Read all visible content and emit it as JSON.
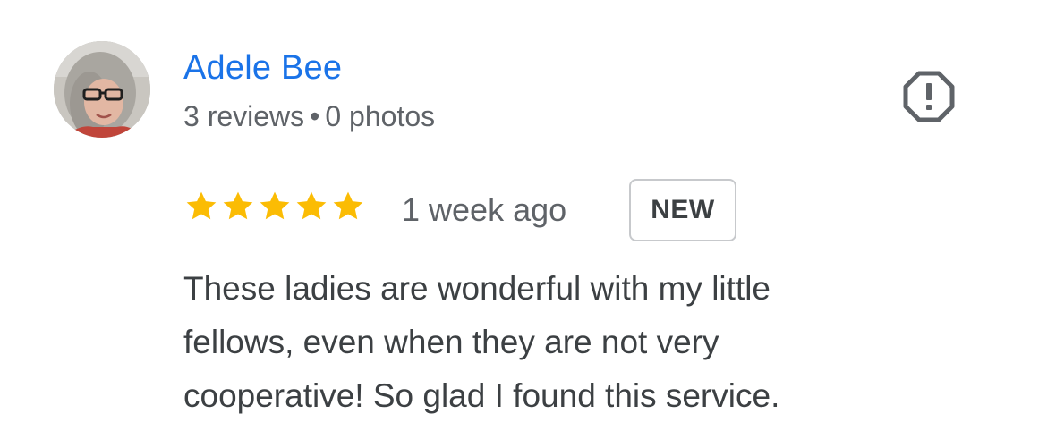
{
  "reviewer": {
    "name": "Adele Bee",
    "reviews": "3 reviews",
    "separator": "•",
    "photos": "0 photos"
  },
  "review": {
    "rating": 5,
    "rating_max": 5,
    "date": "1 week ago",
    "badge": "NEW",
    "text_lines": [
      "These ladies are wonderful with my little",
      "fellows, even when they are not very",
      "cooperative! So glad I found this service."
    ]
  },
  "icons": {
    "flag": "report-icon",
    "star": "star-icon"
  },
  "colors": {
    "name": "#1a73e8",
    "star": "#fbbc04",
    "meta": "#5f6368",
    "body": "#3c4043",
    "badge_border": "#c7c9cc"
  }
}
